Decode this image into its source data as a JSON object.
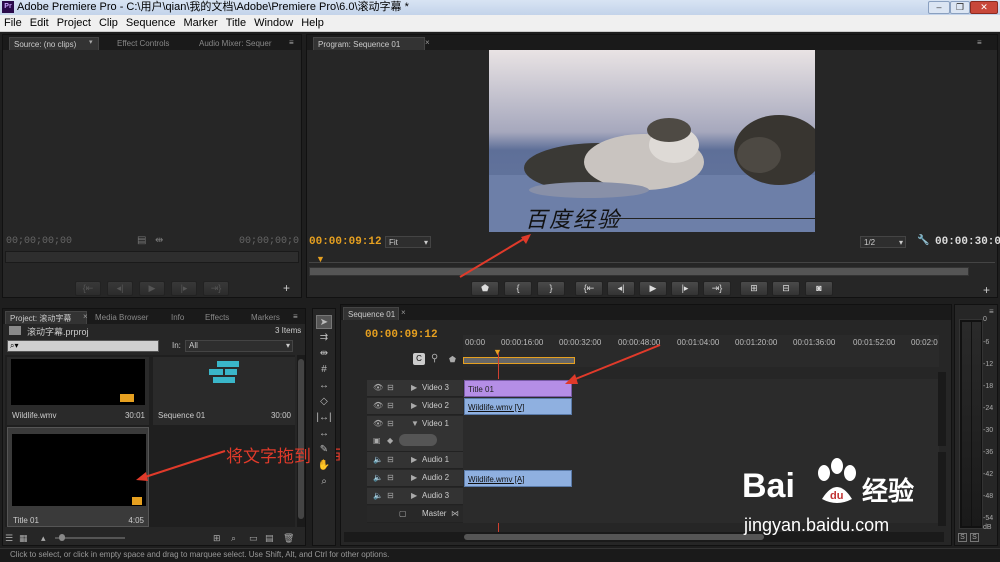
{
  "window": {
    "title": "Adobe Premiere Pro - C:\\用户\\qian\\我的文档\\Adobe\\Premiere Pro\\6.0\\滚动字幕 *",
    "logo": "Pr"
  },
  "menu": [
    "File",
    "Edit",
    "Project",
    "Clip",
    "Sequence",
    "Marker",
    "Title",
    "Window",
    "Help"
  ],
  "source_panel": {
    "tabs": [
      "Source: (no clips)",
      "Effect Controls",
      "Audio Mixer: Sequer"
    ],
    "tc_left": "00;00;00;00",
    "tc_right": "00;00;00;0"
  },
  "program_panel": {
    "tab": "Program: Sequence 01",
    "timecode": "00:00:09:12",
    "fit": "Fit",
    "resolution": "1/2",
    "duration": "00:00:30:00",
    "overlay_text": "百度经验"
  },
  "project_panel": {
    "tabs": [
      "Project: 滚动字幕",
      "Media Browser",
      "Info",
      "Effects",
      "Markers"
    ],
    "project_file": "滚动字幕.prproj",
    "items_count": "3 Items",
    "search_placeholder": "",
    "in_label": "In:",
    "in_value": "All",
    "items": [
      {
        "name": "Wildlife.wmv",
        "duration": "30:01"
      },
      {
        "name": "Sequence 01",
        "duration": "30:00"
      },
      {
        "name": "Title 01",
        "duration": "4:05"
      }
    ]
  },
  "annotation": {
    "text": "将文字拖到时间线"
  },
  "timeline": {
    "tab": "Sequence 01",
    "timecode": "00:00:09:12",
    "ruler": [
      "00:00",
      "00:00:16:00",
      "00:00:32:00",
      "00:00:48:00",
      "00:01:04:00",
      "00:01:20:00",
      "00:01:36:00",
      "00:01:52:00",
      "00:02:0"
    ],
    "tracks": [
      {
        "name": "Video 3",
        "clip": "Title 01"
      },
      {
        "name": "Video 2",
        "clip": "Wildlife.wmv [V]"
      },
      {
        "name": "Video 1",
        "clip": ""
      },
      {
        "name": "Audio 1",
        "clip": ""
      },
      {
        "name": "Audio 2",
        "clip": "Wildlife.wmv [A]"
      },
      {
        "name": "Audio 3",
        "clip": ""
      },
      {
        "name": "Master",
        "clip": ""
      }
    ]
  },
  "vu_meter": {
    "scale": [
      "0",
      "-6",
      "-12",
      "-18",
      "-24",
      "-30",
      "-36",
      "-42",
      "-48",
      "-54",
      "dB"
    ],
    "solo": [
      "S",
      "S"
    ]
  },
  "status_bar": "Click to select, or click in empty space and drag to marquee select. Use Shift, Alt, and Ctrl for other options.",
  "watermark": {
    "brand": "Bai",
    "brand2": "经验",
    "url": "jingyan.baidu.com"
  },
  "colors": {
    "accent": "#e6a020",
    "title_clip": "#b58ee6",
    "video_clip": "#8fb0e0",
    "annotation": "#e03a2a"
  }
}
